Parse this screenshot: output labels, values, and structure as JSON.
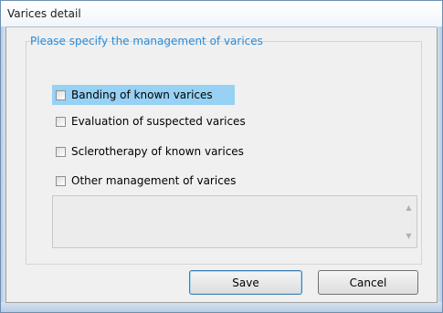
{
  "window": {
    "title": "Varices detail"
  },
  "form": {
    "prompt": "Please specify the management of varices",
    "options": [
      {
        "label": "Banding of known varices",
        "checked": false,
        "highlighted": true
      },
      {
        "label": "Evaluation of suspected varices",
        "checked": false,
        "highlighted": false
      },
      {
        "label": "Sclerotherapy of known varices",
        "checked": false,
        "highlighted": false
      },
      {
        "label": "Other management of varices",
        "checked": false,
        "highlighted": false
      }
    ],
    "notes_value": ""
  },
  "buttons": {
    "save_label": "Save",
    "cancel_label": "Cancel"
  },
  "colors": {
    "prompt": "#2c8cd6",
    "highlight": "#97d1f4",
    "frame": "#cfdbe9"
  },
  "icons": {
    "scroll_up": "up-arrow-icon",
    "scroll_down": "down-arrow-icon"
  }
}
